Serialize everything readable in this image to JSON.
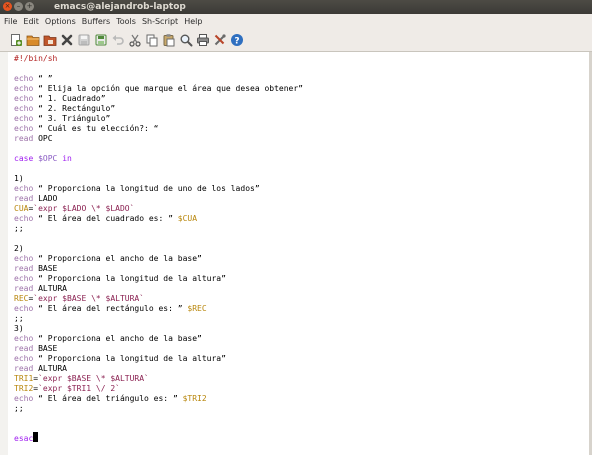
{
  "window": {
    "title": "emacs@alejandrob-laptop",
    "buttons": [
      "close",
      "minimize",
      "maximize"
    ]
  },
  "menubar": {
    "items": [
      "File",
      "Edit",
      "Options",
      "Buffers",
      "Tools",
      "Sh-Script",
      "Help"
    ]
  },
  "toolbar": {
    "items": [
      {
        "name": "new-file-icon",
        "color": "#5a8f29"
      },
      {
        "name": "open-folder-icon",
        "color": "#d88a2a"
      },
      {
        "name": "dired-icon",
        "color": "#c0562b"
      },
      {
        "name": "close-buffer-icon",
        "color": "#444444"
      },
      {
        "name": "save-icon",
        "color": "#b9b9b9"
      },
      {
        "name": "save-as-icon",
        "color": "#4f8a3a"
      },
      {
        "name": "undo-icon",
        "color": "#b9b9b9"
      },
      {
        "name": "cut-icon",
        "color": "#6a6a6a"
      },
      {
        "name": "copy-icon",
        "color": "#6a6a6a"
      },
      {
        "name": "paste-icon",
        "color": "#7a6a4a"
      },
      {
        "name": "search-icon",
        "color": "#555555"
      },
      {
        "name": "print-icon",
        "color": "#555555"
      },
      {
        "name": "preferences-icon",
        "color": "#b8452a"
      },
      {
        "name": "help-icon",
        "color": "#2f6fc0"
      }
    ]
  },
  "editor": {
    "lines": [
      [
        {
          "t": "#!/bin/sh",
          "c": "comment"
        }
      ],
      [],
      [
        {
          "t": "echo",
          "c": "builtin"
        },
        {
          "t": " “ ”",
          "c": "plain"
        }
      ],
      [
        {
          "t": "echo",
          "c": "builtin"
        },
        {
          "t": " “ Elija la opción que marque el área que desea obtener”",
          "c": "plain"
        }
      ],
      [
        {
          "t": "echo",
          "c": "builtin"
        },
        {
          "t": " “ 1. Cuadrado”",
          "c": "plain"
        }
      ],
      [
        {
          "t": "echo",
          "c": "builtin"
        },
        {
          "t": " “ 2. Rectángulo”",
          "c": "plain"
        }
      ],
      [
        {
          "t": "echo",
          "c": "builtin"
        },
        {
          "t": " “ 3. Triángulo”",
          "c": "plain"
        }
      ],
      [
        {
          "t": "echo",
          "c": "builtin"
        },
        {
          "t": " “ Cuál es tu elección?: “",
          "c": "plain"
        }
      ],
      [
        {
          "t": "read",
          "c": "builtin"
        },
        {
          "t": " OPC",
          "c": "plain"
        }
      ],
      [],
      [
        {
          "t": "case",
          "c": "keyword"
        },
        {
          "t": " ",
          "c": "plain"
        },
        {
          "t": "$OPC",
          "c": "varref"
        },
        {
          "t": " ",
          "c": "plain"
        },
        {
          "t": "in",
          "c": "keyword"
        }
      ],
      [],
      [
        {
          "t": "1)",
          "c": "plain"
        }
      ],
      [
        {
          "t": "echo",
          "c": "builtin"
        },
        {
          "t": " “ Proporciona la longitud de uno de los lados”",
          "c": "plain"
        }
      ],
      [
        {
          "t": "read",
          "c": "builtin"
        },
        {
          "t": " LADO",
          "c": "plain"
        }
      ],
      [
        {
          "t": "CUA",
          "c": "var"
        },
        {
          "t": "=",
          "c": "plain"
        },
        {
          "t": "`expr $LADO \\* $LADO`",
          "c": "string"
        }
      ],
      [
        {
          "t": "echo",
          "c": "builtin"
        },
        {
          "t": " “ El área del cuadrado es: ” ",
          "c": "plain"
        },
        {
          "t": "$CUA",
          "c": "var"
        }
      ],
      [
        {
          "t": ";;",
          "c": "plain"
        }
      ],
      [],
      [
        {
          "t": "2)",
          "c": "plain"
        }
      ],
      [
        {
          "t": "echo",
          "c": "builtin"
        },
        {
          "t": " “ Proporciona el ancho de la base”",
          "c": "plain"
        }
      ],
      [
        {
          "t": "read",
          "c": "builtin"
        },
        {
          "t": " BASE",
          "c": "plain"
        }
      ],
      [
        {
          "t": "echo",
          "c": "builtin"
        },
        {
          "t": " “ Proporciona la longitud de la altura”",
          "c": "plain"
        }
      ],
      [
        {
          "t": "read",
          "c": "builtin"
        },
        {
          "t": " ALTURA",
          "c": "plain"
        }
      ],
      [
        {
          "t": "REC",
          "c": "var"
        },
        {
          "t": "=",
          "c": "plain"
        },
        {
          "t": "`expr $BASE \\* $ALTURA`",
          "c": "string"
        }
      ],
      [
        {
          "t": "echo",
          "c": "builtin"
        },
        {
          "t": " “ El área del rectángulo es: ” ",
          "c": "plain"
        },
        {
          "t": "$REC",
          "c": "var"
        }
      ],
      [
        {
          "t": ";;",
          "c": "plain"
        }
      ],
      [
        {
          "t": "3)",
          "c": "plain"
        }
      ],
      [
        {
          "t": "echo",
          "c": "builtin"
        },
        {
          "t": " “ Proporciona el ancho de la base”",
          "c": "plain"
        }
      ],
      [
        {
          "t": "read",
          "c": "builtin"
        },
        {
          "t": " BASE",
          "c": "plain"
        }
      ],
      [
        {
          "t": "echo",
          "c": "builtin"
        },
        {
          "t": " “ Proporciona la longitud de la altura”",
          "c": "plain"
        }
      ],
      [
        {
          "t": "read",
          "c": "builtin"
        },
        {
          "t": " ALTURA",
          "c": "plain"
        }
      ],
      [
        {
          "t": "TRI1",
          "c": "var"
        },
        {
          "t": "=",
          "c": "plain"
        },
        {
          "t": "`expr $BASE \\* $ALTURA`",
          "c": "string"
        }
      ],
      [
        {
          "t": "TRI2",
          "c": "var"
        },
        {
          "t": "=",
          "c": "plain"
        },
        {
          "t": "`expr $TRI1 \\/ 2`",
          "c": "string"
        }
      ],
      [
        {
          "t": "echo",
          "c": "builtin"
        },
        {
          "t": " “ El área del triángulo es: ” ",
          "c": "plain"
        },
        {
          "t": "$TRI2",
          "c": "var"
        }
      ],
      [
        {
          "t": ";;",
          "c": "plain"
        }
      ],
      [],
      [],
      [
        {
          "t": "esac",
          "c": "keyword"
        }
      ]
    ]
  }
}
